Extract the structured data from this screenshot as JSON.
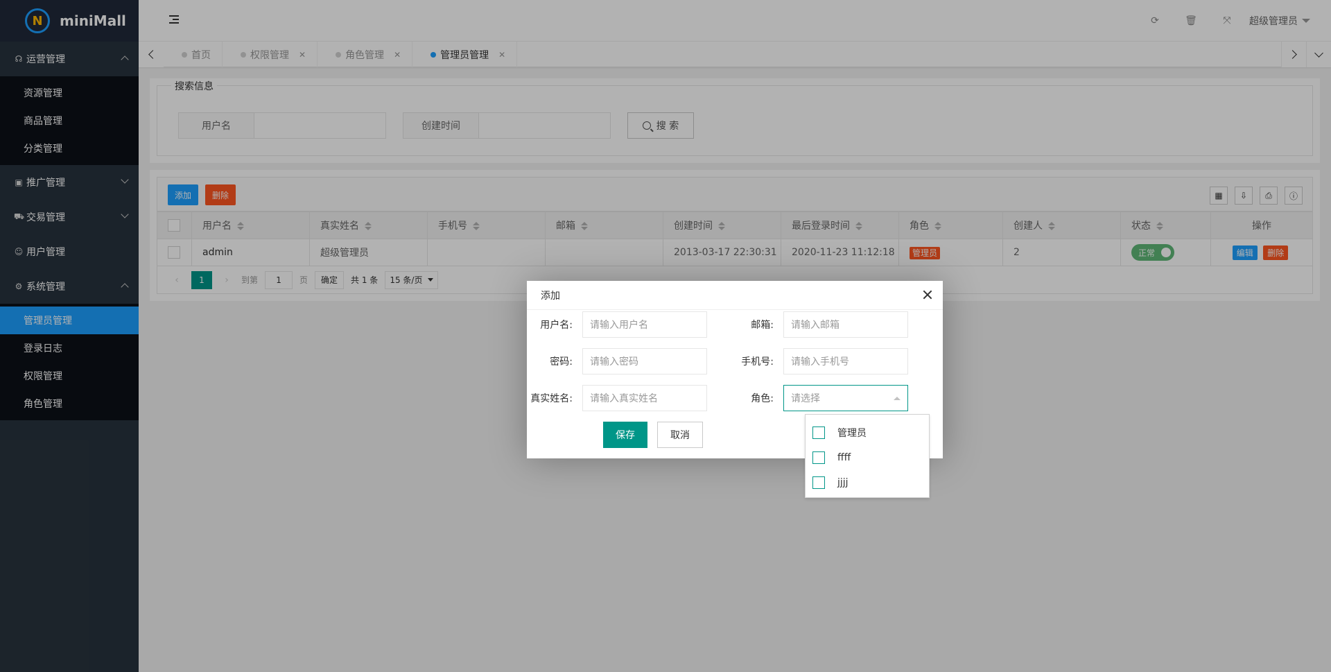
{
  "app": {
    "logo_mark": "N",
    "name": "miniMall"
  },
  "sidebar": {
    "groups": [
      {
        "label": "运营管理",
        "icon": "headset-icon",
        "items": [
          "资源管理",
          "商品管理",
          "分类管理"
        ]
      },
      {
        "label": "推广管理",
        "icon": "gift-icon"
      },
      {
        "label": "交易管理",
        "icon": "cart-icon"
      },
      {
        "label": "用户管理",
        "icon": "user-icon"
      },
      {
        "label": "系统管理",
        "icon": "gear-icon",
        "items": [
          "管理员管理",
          "登录日志",
          "权限管理",
          "角色管理"
        ]
      }
    ],
    "active_item": "管理员管理"
  },
  "header": {
    "user": "超级管理员",
    "icons": [
      "refresh-icon",
      "trash-icon",
      "fullscreen-icon"
    ]
  },
  "tabs": [
    {
      "label": "首页",
      "closable": false,
      "active": false
    },
    {
      "label": "权限管理",
      "closable": true,
      "active": false
    },
    {
      "label": "角色管理",
      "closable": true,
      "active": false
    },
    {
      "label": "管理员管理",
      "closable": true,
      "active": true
    }
  ],
  "search": {
    "legend": "搜索信息",
    "username_label": "用户名",
    "created_label": "创建时间",
    "button": "搜 索"
  },
  "toolbar": {
    "add": "添加",
    "delete": "删除"
  },
  "table": {
    "columns": [
      "用户名",
      "真实姓名",
      "手机号",
      "邮箱",
      "创建时间",
      "最后登录时间",
      "角色",
      "创建人",
      "状态",
      "操作"
    ],
    "rows": [
      {
        "username": "admin",
        "realname": "超级管理员",
        "phone": "",
        "email": "",
        "created": "2013-03-17 22:30:31",
        "last_login": "2020-11-23 11:12:18",
        "role": "管理员",
        "creator": "2",
        "status": "正常",
        "edit": "编辑",
        "delete": "删除"
      }
    ]
  },
  "pager": {
    "current": "1",
    "goto_label": "到第",
    "goto_value": "1",
    "page_label": "页",
    "confirm": "确定",
    "total": "共 1 条",
    "per_page": "15 条/页"
  },
  "dialog": {
    "title": "添加",
    "username_label": "用户名:",
    "username_placeholder": "请输入用户名",
    "email_label": "邮箱:",
    "email_placeholder": "请输入邮箱",
    "password_label": "密码:",
    "password_placeholder": "请输入密码",
    "phone_label": "手机号:",
    "phone_placeholder": "请输入手机号",
    "realname_label": "真实姓名:",
    "realname_placeholder": "请输入真实姓名",
    "role_label": "角色:",
    "role_placeholder": "请选择",
    "save": "保存",
    "cancel": "取消",
    "role_options": [
      "管理员",
      "ffff",
      "jjjj"
    ]
  },
  "colors": {
    "sidebar_bg": "#28333e",
    "active_blue": "#1e9fff",
    "primary_green": "#009688",
    "danger": "#ff5722",
    "status_green": "#5fb878"
  }
}
